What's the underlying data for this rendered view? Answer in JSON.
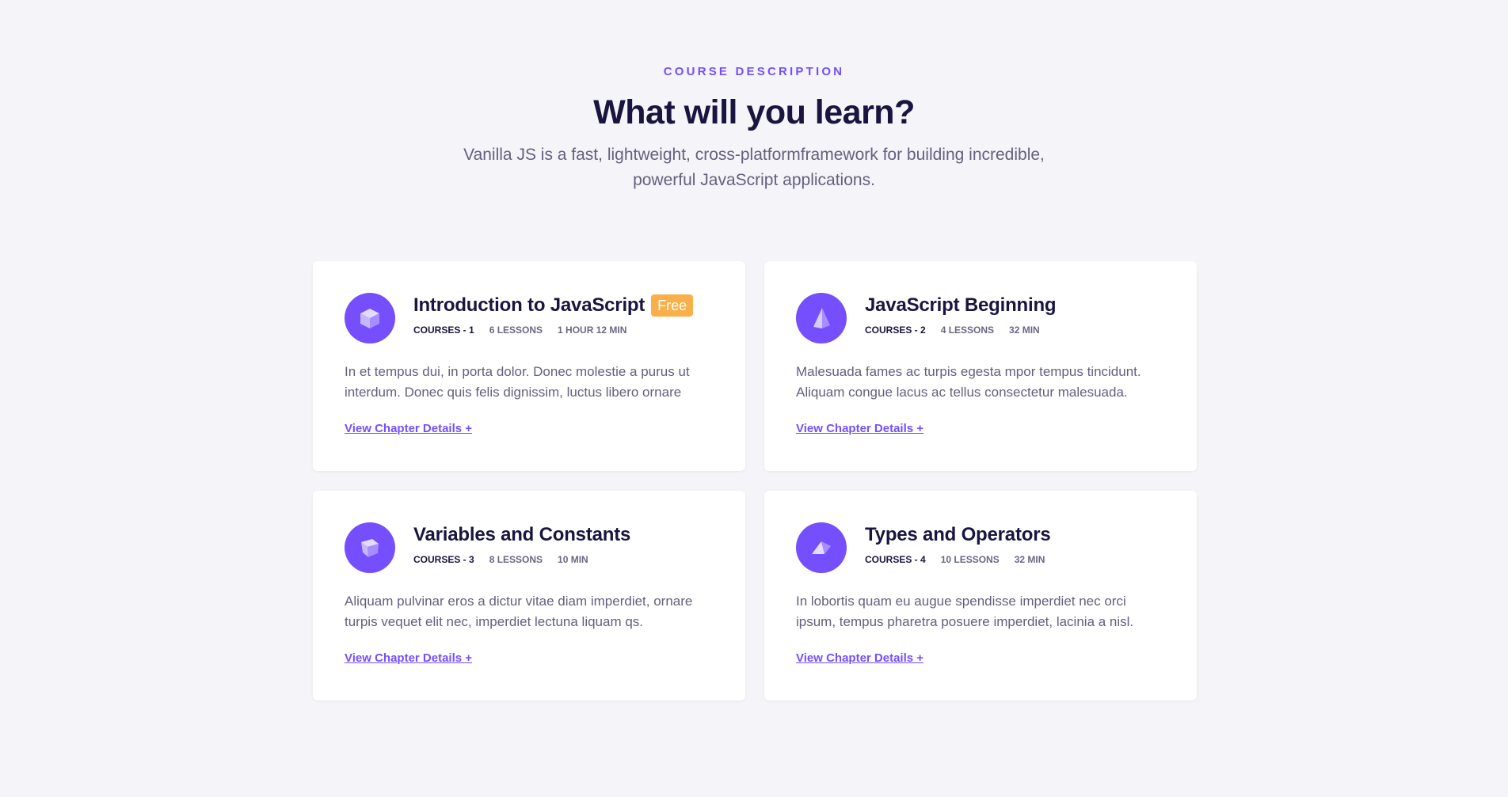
{
  "header": {
    "eyebrow": "COURSE DESCRIPTION",
    "title": "What will you learn?",
    "subtitle": "Vanilla JS is a fast, lightweight, cross-platformframework for building incredible, powerful JavaScript applications."
  },
  "colors": {
    "accent": "#754ffe",
    "badge": "#f9b04a",
    "background": "#f5f4f8",
    "heading": "#19153f"
  },
  "cards": [
    {
      "icon": "cube-icon",
      "title": "Introduction to JavaScript",
      "badge": "Free",
      "course": "COURSES - 1",
      "lessons": "6 LESSONS",
      "duration": "1 HOUR 12 MIN",
      "description": "In et tempus dui, in porta dolor. Donec molestie a purus ut interdum. Donec quis felis dignissim, luctus libero ornare",
      "link": "View Chapter Details +"
    },
    {
      "icon": "pyramid-icon",
      "title": "JavaScript Beginning",
      "course": "COURSES - 2",
      "lessons": "4 LESSONS",
      "duration": "32 MIN",
      "description": "Malesuada fames ac turpis egesta mpor tempus tincidunt. Aliquam congue lacus ac tellus consectetur malesuada.",
      "link": "View Chapter Details +"
    },
    {
      "icon": "tilted-cube-icon",
      "title": "Variables and Constants",
      "course": "COURSES - 3",
      "lessons": "8 LESSONS",
      "duration": "10 MIN",
      "description": "Aliquam pulvinar eros a dictur vitae diam imperdiet, ornare turpis vequet elit nec, imperdiet lectuna liquam qs.",
      "link": "View Chapter Details +"
    },
    {
      "icon": "prism-icon",
      "title": "Types and Operators",
      "course": "COURSES - 4",
      "lessons": "10 LESSONS",
      "duration": "32 MIN",
      "description": "In lobortis quam eu augue spendisse imperdiet nec orci ipsum, tempus pharetra posuere imperdiet, lacinia a nisl.",
      "link": "View Chapter Details +"
    }
  ]
}
